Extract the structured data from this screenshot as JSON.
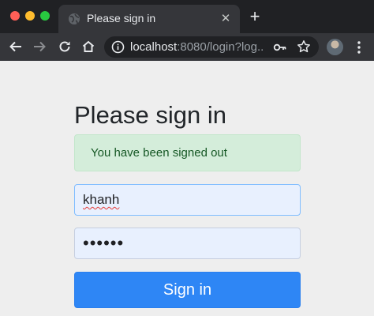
{
  "browser": {
    "tab": {
      "title": "Please sign in",
      "close_glyph": "✕",
      "icon": "globe-icon"
    },
    "new_tab_glyph": "+",
    "toolbar": {
      "back_icon": "arrow-left-icon",
      "forward_icon": "arrow-right-icon",
      "reload_icon": "reload-icon",
      "home_icon": "home-icon",
      "url_host": "localhost",
      "url_rest": ":8080/login?log...",
      "key_icon": "key-icon",
      "star_icon": "star-icon",
      "menu_icon": "more-vertical-icon"
    },
    "colors": {
      "tabstrip_bg": "#202124",
      "toolbar_bg": "#35363a",
      "traffic_red": "#ff5f57",
      "traffic_yellow": "#febc2e",
      "traffic_green": "#28c840"
    }
  },
  "login": {
    "heading": "Please sign in",
    "alert": "You have been signed out",
    "username_value": "khanh",
    "password_value": "••••••",
    "submit_label": "Sign in",
    "colors": {
      "alert_bg": "#d4edda",
      "alert_text": "#155724",
      "input_bg": "#e8f0fe",
      "button_bg": "#2e86f5"
    }
  }
}
